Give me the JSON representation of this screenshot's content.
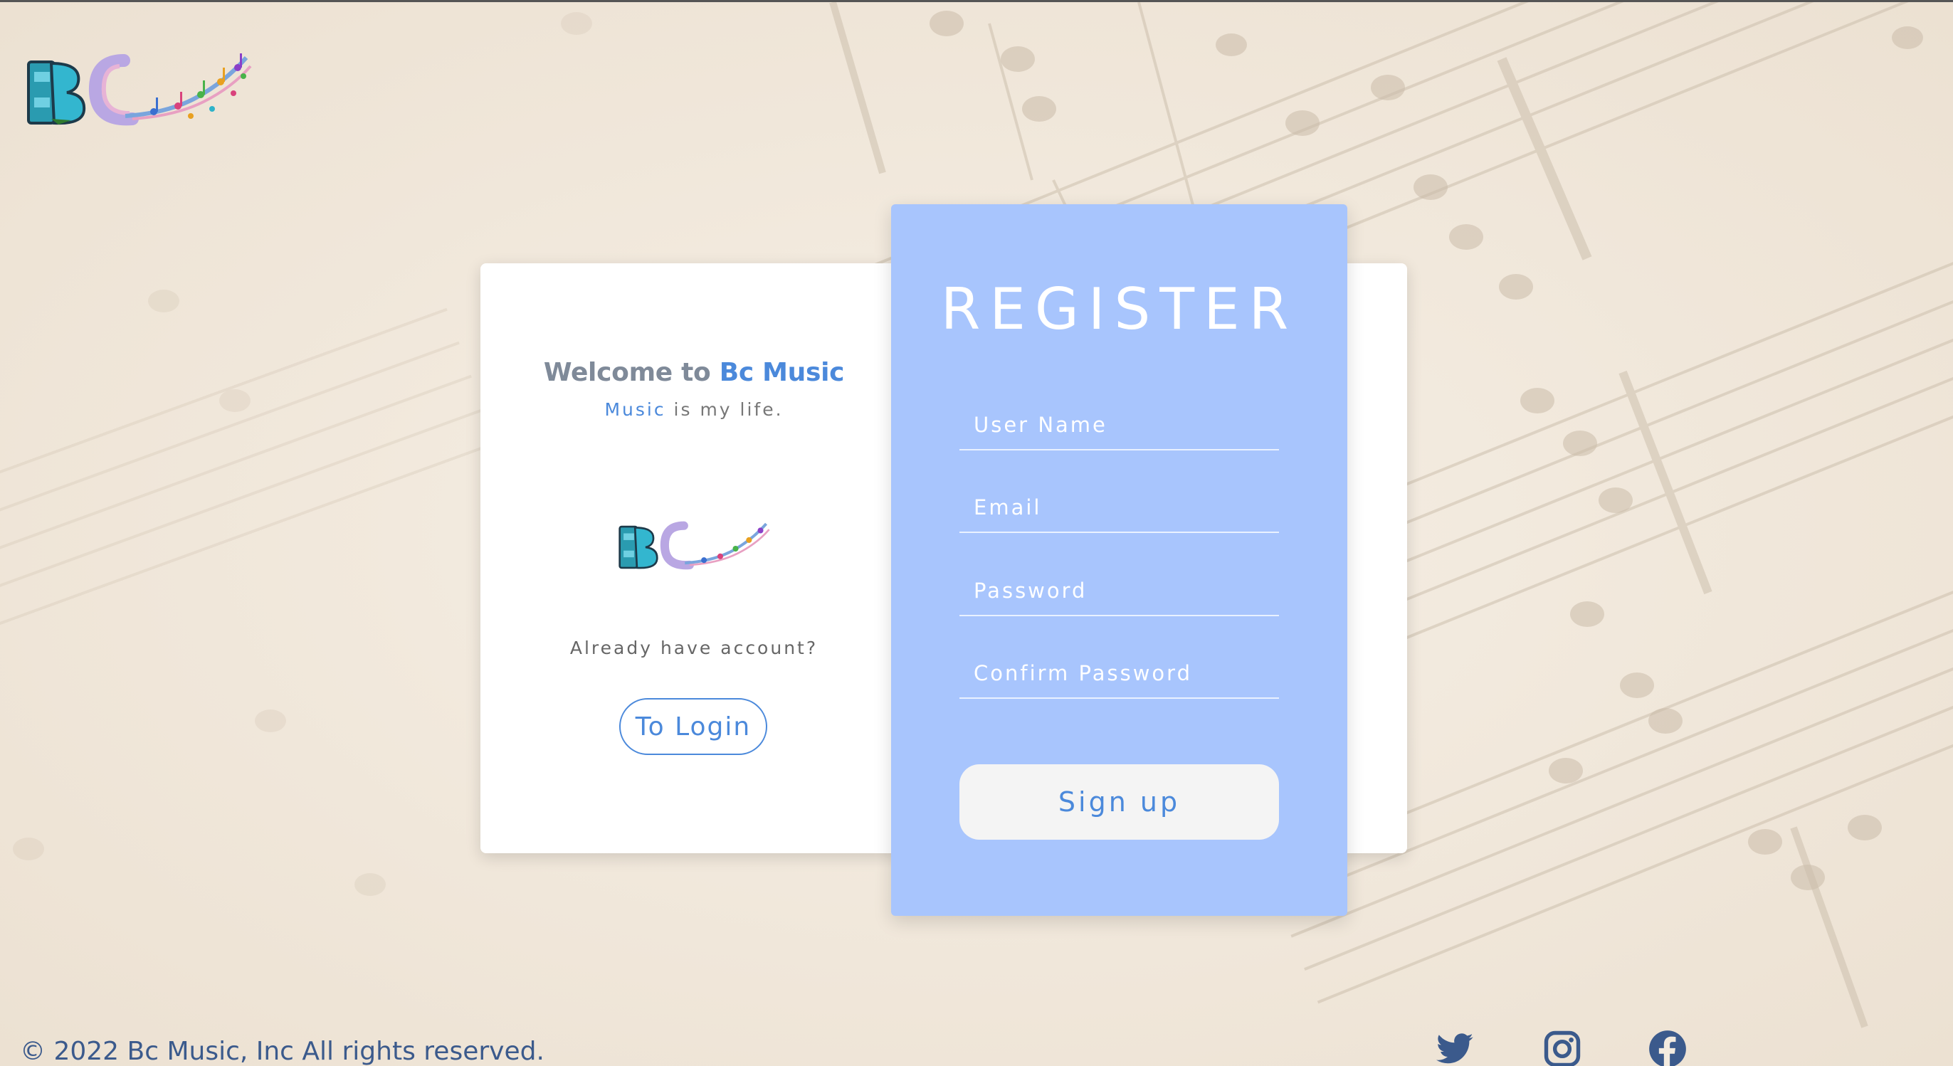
{
  "brand": {
    "logo_alt": "Bc Music"
  },
  "welcome": {
    "prefix": "Welcome to ",
    "brand_name": "Bc Music",
    "tagline_accent": "Music",
    "tagline_rest": " is my life.",
    "already_text": "Already have account?",
    "login_button": "To Login"
  },
  "register": {
    "title": "REGISTER",
    "fields": {
      "username_placeholder": "User Name",
      "email_placeholder": "Email",
      "password_placeholder": "Password",
      "confirm_placeholder": "Confirm Password"
    },
    "submit_label": "Sign up"
  },
  "footer": {
    "copyright": "© 2022 Bc Music, Inc All rights reserved.",
    "social": [
      "twitter-icon",
      "instagram-icon",
      "facebook-icon"
    ]
  },
  "colors": {
    "accent": "#4b89db",
    "panel": "#a8c5fd",
    "background": "#f3ebdf",
    "footer_text": "#3b5a8c"
  }
}
